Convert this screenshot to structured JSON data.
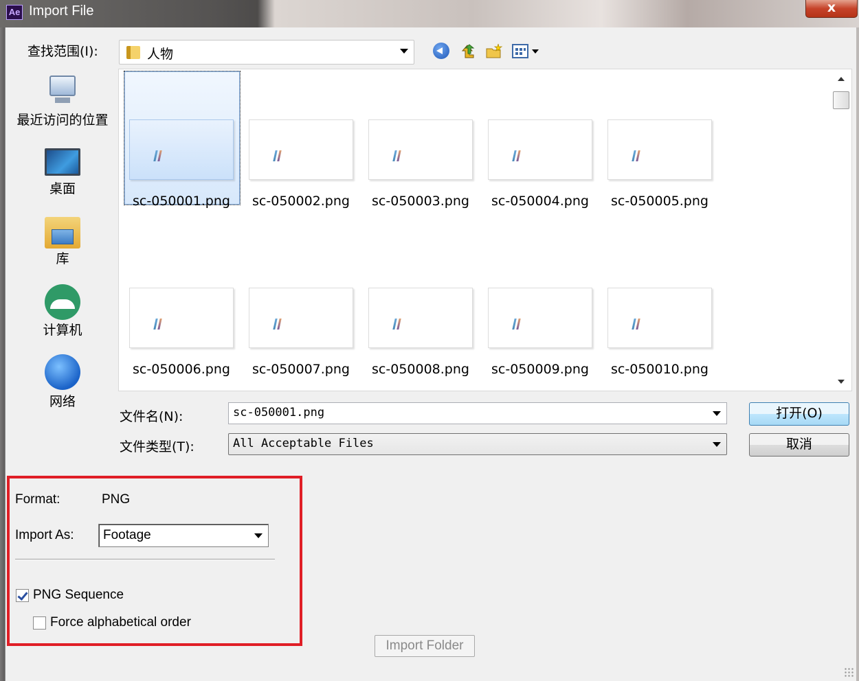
{
  "window": {
    "app_icon": "Ae",
    "title": "Import File",
    "close_label": "x"
  },
  "toolbar": {
    "lookin_label": "查找范围(I):",
    "lookin_value": "人物",
    "icons": [
      "back-icon",
      "up-folder-icon",
      "new-folder-icon",
      "view-menu-icon"
    ]
  },
  "places": [
    {
      "label": "最近访问的位置",
      "icon": "recent-places-icon"
    },
    {
      "label": "桌面",
      "icon": "desktop-icon"
    },
    {
      "label": "库",
      "icon": "libraries-icon"
    },
    {
      "label": "计算机",
      "icon": "computer-icon"
    },
    {
      "label": "网络",
      "icon": "network-icon"
    }
  ],
  "files": [
    "sc-050001.png",
    "sc-050002.png",
    "sc-050003.png",
    "sc-050004.png",
    "sc-050005.png",
    "sc-050006.png",
    "sc-050007.png",
    "sc-050008.png",
    "sc-050009.png",
    "sc-050010.png"
  ],
  "selected_file_index": 0,
  "filename": {
    "label": "文件名(N):",
    "value": "sc-050001.png"
  },
  "filetype": {
    "label": "文件类型(T):",
    "value": "All Acceptable Files"
  },
  "buttons": {
    "open": "打开(O)",
    "cancel": "取消",
    "import_folder": "Import Folder"
  },
  "options": {
    "format_label": "Format:",
    "format_value": "PNG",
    "import_as_label": "Import As:",
    "import_as_value": "Footage",
    "png_sequence_label": "PNG Sequence",
    "png_sequence_checked": true,
    "force_alpha_label": "Force alphabetical order",
    "force_alpha_checked": false
  },
  "colors": {
    "highlight_box": "#e01e26",
    "selection": "#cbe1fa"
  }
}
